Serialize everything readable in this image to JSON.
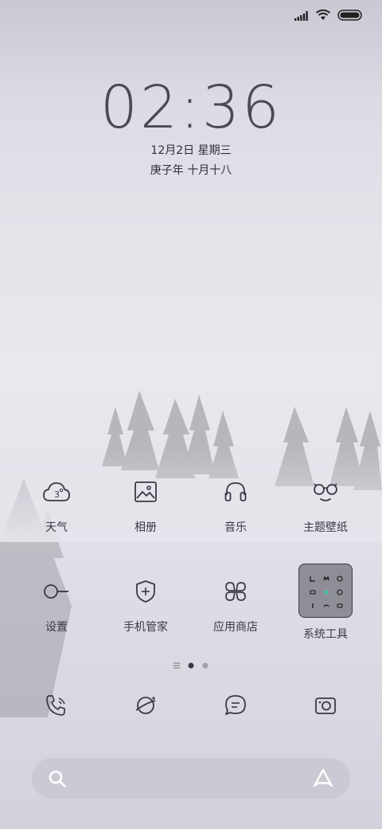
{
  "status_bar": {
    "icons": [
      "signal-icon",
      "wifi-icon",
      "battery-icon"
    ]
  },
  "lockscreen": {
    "time": "02:36",
    "date": "12月2日 星期三",
    "lunar": "庚子年 十月十八"
  },
  "apps": [
    {
      "label": "天气",
      "icon": "weather-icon"
    },
    {
      "label": "相册",
      "icon": "gallery-icon"
    },
    {
      "label": "音乐",
      "icon": "music-icon"
    },
    {
      "label": "主题壁纸",
      "icon": "themes-icon"
    },
    {
      "label": "设置",
      "icon": "settings-icon"
    },
    {
      "label": "手机管家",
      "icon": "security-icon"
    },
    {
      "label": "应用商店",
      "icon": "app-store-icon"
    },
    {
      "label": "系统工具",
      "icon": "tools-folder-icon"
    }
  ],
  "weather_temp": "3",
  "dock": [
    "phone-icon",
    "browser-icon",
    "messages-icon",
    "camera-icon"
  ],
  "page_indicator": {
    "pages": 2,
    "active": 1
  },
  "search_bar": {
    "left_icon": "search-icon",
    "right_icon": "assistant-icon"
  }
}
